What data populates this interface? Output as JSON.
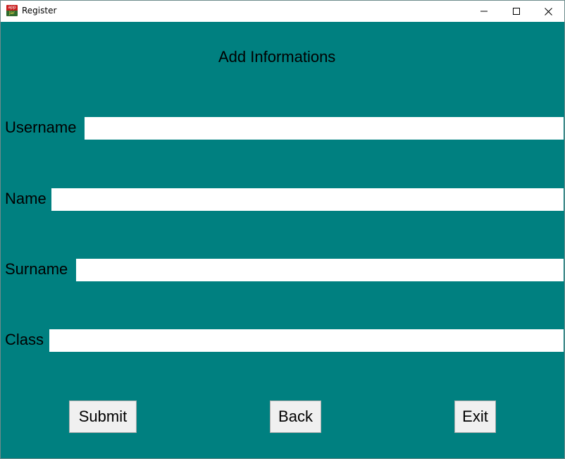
{
  "window": {
    "title": "Register",
    "icon": "app-jar-icon",
    "icon_top_text": "app",
    "icon_bottom_text": "Jar",
    "controls": [
      "minimize-icon",
      "maximize-icon",
      "close-icon"
    ]
  },
  "form": {
    "heading": "Add Informations",
    "fields": [
      {
        "label": "Username",
        "value": ""
      },
      {
        "label": "Name",
        "value": ""
      },
      {
        "label": "Surname",
        "value": ""
      },
      {
        "label": "Class",
        "value": ""
      }
    ]
  },
  "buttons": {
    "submit": "Submit",
    "back": "Back",
    "exit": "Exit"
  },
  "colors": {
    "background": "#008080",
    "input": "#ffffff",
    "button": "#f0f0f0"
  }
}
